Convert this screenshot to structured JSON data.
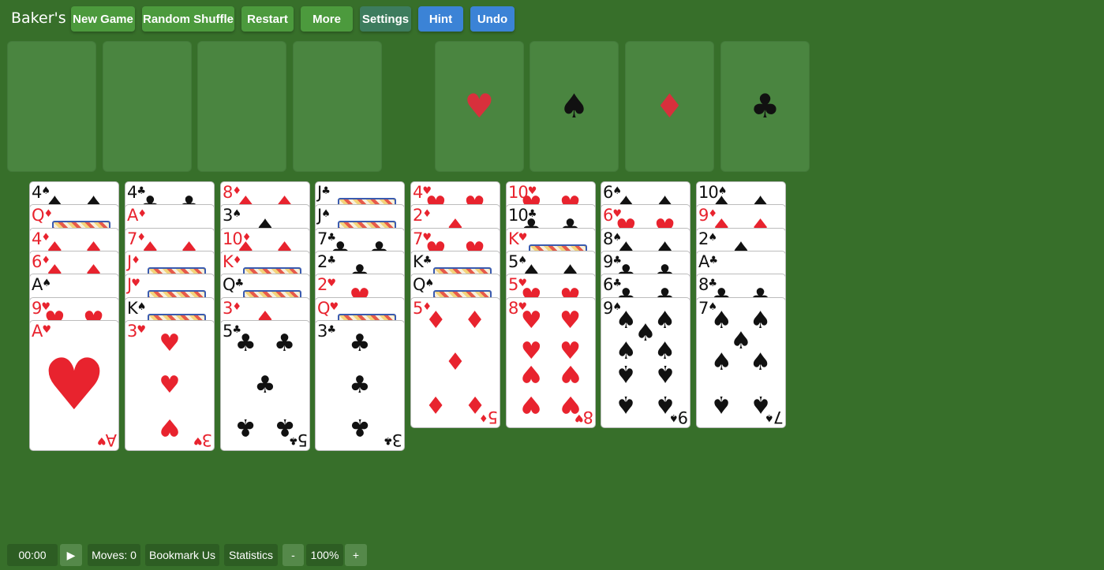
{
  "app": {
    "title": "Baker's"
  },
  "toolbar": {
    "new_game": "New Game",
    "random_shuffle": "Random Shuffle",
    "restart": "Restart",
    "more": "More",
    "settings": "Settings",
    "hint": "Hint",
    "undo": "Undo"
  },
  "colors": {
    "table": "#376f2a",
    "slot": "#4a8540",
    "red_suit": "#e8232e",
    "black_suit": "#111111",
    "hint_undo_blue": "#3b83d6"
  },
  "foundations": [
    {
      "suit": "hearts",
      "glyph": "♥",
      "color": "red"
    },
    {
      "suit": "spades",
      "glyph": "♠",
      "color": "black"
    },
    {
      "suit": "diamonds",
      "glyph": "♦",
      "color": "red"
    },
    {
      "suit": "clubs",
      "glyph": "♣",
      "color": "black"
    }
  ],
  "tableau": [
    [
      {
        "rank": "4",
        "suit": "♠",
        "color": "black"
      },
      {
        "rank": "Q",
        "suit": "♦",
        "color": "red"
      },
      {
        "rank": "4",
        "suit": "♦",
        "color": "red"
      },
      {
        "rank": "6",
        "suit": "♦",
        "color": "red"
      },
      {
        "rank": "A",
        "suit": "♠",
        "color": "black"
      },
      {
        "rank": "9",
        "suit": "♥",
        "color": "red"
      },
      {
        "rank": "A",
        "suit": "♥",
        "color": "red"
      }
    ],
    [
      {
        "rank": "4",
        "suit": "♣",
        "color": "black"
      },
      {
        "rank": "A",
        "suit": "♦",
        "color": "red"
      },
      {
        "rank": "7",
        "suit": "♦",
        "color": "red"
      },
      {
        "rank": "J",
        "suit": "♦",
        "color": "red"
      },
      {
        "rank": "J",
        "suit": "♥",
        "color": "red"
      },
      {
        "rank": "K",
        "suit": "♠",
        "color": "black"
      },
      {
        "rank": "3",
        "suit": "♥",
        "color": "red"
      }
    ],
    [
      {
        "rank": "8",
        "suit": "♦",
        "color": "red"
      },
      {
        "rank": "3",
        "suit": "♠",
        "color": "black"
      },
      {
        "rank": "10",
        "suit": "♦",
        "color": "red"
      },
      {
        "rank": "K",
        "suit": "♦",
        "color": "red"
      },
      {
        "rank": "Q",
        "suit": "♣",
        "color": "black"
      },
      {
        "rank": "3",
        "suit": "♦",
        "color": "red"
      },
      {
        "rank": "5",
        "suit": "♣",
        "color": "black"
      }
    ],
    [
      {
        "rank": "J",
        "suit": "♣",
        "color": "black"
      },
      {
        "rank": "J",
        "suit": "♠",
        "color": "black"
      },
      {
        "rank": "7",
        "suit": "♣",
        "color": "black"
      },
      {
        "rank": "2",
        "suit": "♣",
        "color": "black"
      },
      {
        "rank": "2",
        "suit": "♥",
        "color": "red"
      },
      {
        "rank": "Q",
        "suit": "♥",
        "color": "red"
      },
      {
        "rank": "3",
        "suit": "♣",
        "color": "black"
      }
    ],
    [
      {
        "rank": "4",
        "suit": "♥",
        "color": "red"
      },
      {
        "rank": "2",
        "suit": "♦",
        "color": "red"
      },
      {
        "rank": "7",
        "suit": "♥",
        "color": "red"
      },
      {
        "rank": "K",
        "suit": "♣",
        "color": "black"
      },
      {
        "rank": "Q",
        "suit": "♠",
        "color": "black"
      },
      {
        "rank": "5",
        "suit": "♦",
        "color": "red"
      }
    ],
    [
      {
        "rank": "10",
        "suit": "♥",
        "color": "red"
      },
      {
        "rank": "10",
        "suit": "♣",
        "color": "black"
      },
      {
        "rank": "K",
        "suit": "♥",
        "color": "red"
      },
      {
        "rank": "5",
        "suit": "♠",
        "color": "black"
      },
      {
        "rank": "5",
        "suit": "♥",
        "color": "red"
      },
      {
        "rank": "8",
        "suit": "♥",
        "color": "red"
      }
    ],
    [
      {
        "rank": "6",
        "suit": "♠",
        "color": "black"
      },
      {
        "rank": "6",
        "suit": "♥",
        "color": "red"
      },
      {
        "rank": "8",
        "suit": "♠",
        "color": "black"
      },
      {
        "rank": "9",
        "suit": "♣",
        "color": "black"
      },
      {
        "rank": "6",
        "suit": "♣",
        "color": "black"
      },
      {
        "rank": "9",
        "suit": "♠",
        "color": "black"
      }
    ],
    [
      {
        "rank": "10",
        "suit": "♠",
        "color": "black"
      },
      {
        "rank": "9",
        "suit": "♦",
        "color": "red"
      },
      {
        "rank": "2",
        "suit": "♠",
        "color": "black"
      },
      {
        "rank": "A",
        "suit": "♣",
        "color": "black"
      },
      {
        "rank": "8",
        "suit": "♣",
        "color": "black"
      },
      {
        "rank": "7",
        "suit": "♠",
        "color": "black"
      }
    ]
  ],
  "status": {
    "timer": "00:00",
    "play_glyph": "▶",
    "moves": "Moves: 0",
    "bookmark": "Bookmark Us",
    "statistics": "Statistics",
    "zoom_out": "-",
    "zoom": "100%",
    "zoom_in": "+"
  }
}
